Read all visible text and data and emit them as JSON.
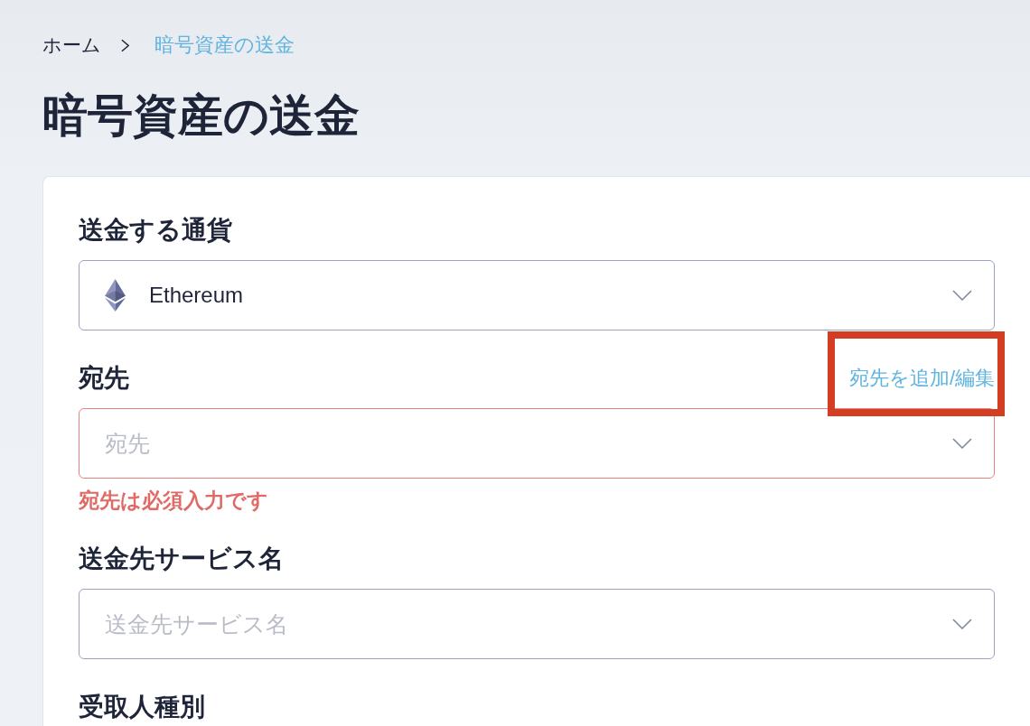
{
  "breadcrumb": [
    {
      "label": "ホーム",
      "current": false
    },
    {
      "label": "暗号資産の送金",
      "current": true
    }
  ],
  "page_title": "暗号資産の送金",
  "form": {
    "fields": [
      {
        "kind": "currency_select",
        "label": "送金する通貨",
        "value": "Ethereum",
        "invalid": false
      },
      {
        "kind": "select",
        "label": "宛先",
        "link": {
          "label": "宛先を追加/編集",
          "highlighted": true
        },
        "placeholder": "宛先",
        "invalid": true,
        "error": "宛先は必須入力です"
      },
      {
        "kind": "select",
        "label": "送金先サービス名",
        "placeholder": "送金先サービス名",
        "invalid": false
      },
      {
        "kind": "label_only",
        "label": "受取人種別"
      }
    ]
  }
}
